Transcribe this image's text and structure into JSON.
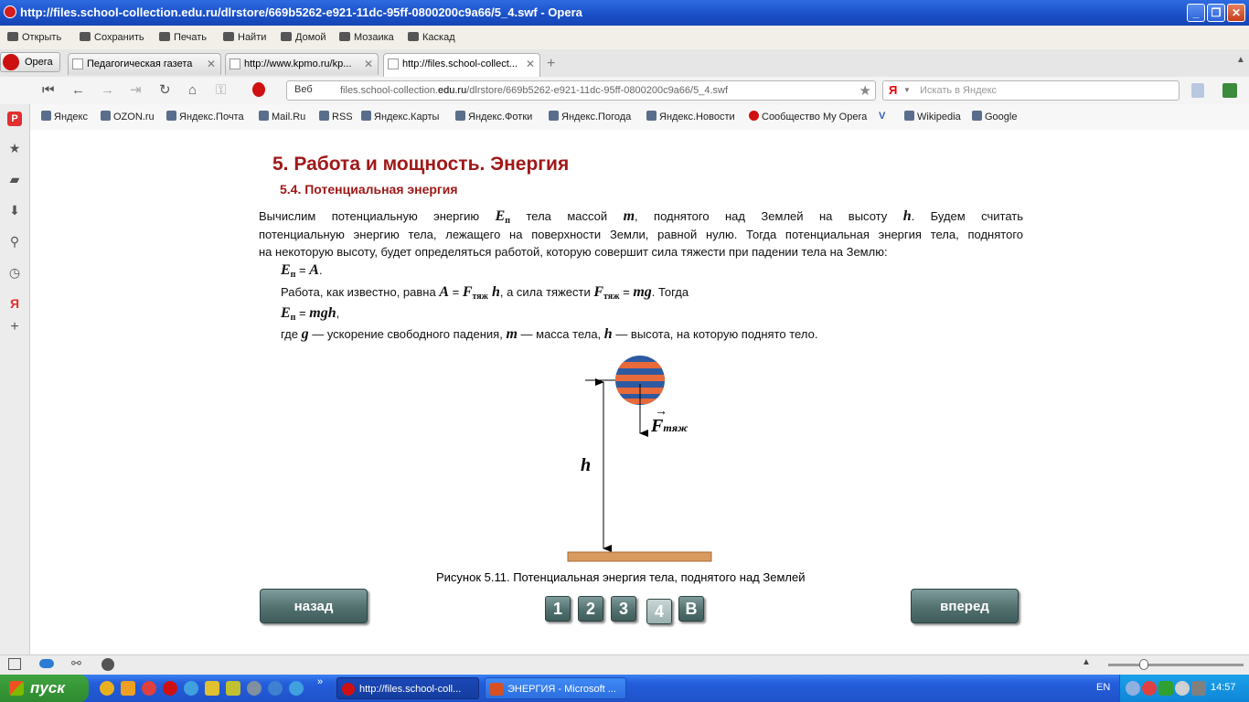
{
  "window": {
    "title": "http://files.school-collection.edu.ru/dlrstore/669b5262-e921-11dc-95ff-0800200c9a66/5_4.swf - Opera"
  },
  "menu": [
    "Открыть",
    "Сохранить",
    "Печать",
    "Найти",
    "Домой",
    "Мозаика",
    "Каскад"
  ],
  "opera_button": "Opera",
  "tabs": [
    "Педагогическая газета",
    "http://www.kpmo.ru/kp...",
    "http://files.school-collect..."
  ],
  "address": {
    "web_label": "Веб",
    "url_prefix": "files.school-collection.",
    "url_host": "edu.ru",
    "url_path": "/dlrstore/669b5262-e921-11dc-95ff-0800200c9a66/5_4.swf"
  },
  "search": {
    "engine": "Я",
    "placeholder": "Искать в Яндекс"
  },
  "bookmarks": [
    "Яндекс",
    "OZON.ru",
    "Яндекс.Почта",
    "Mail.Ru",
    "RSS",
    "Яндекс.Карты",
    "Яндекс.Фотки",
    "Яндекс.Погода",
    "Яндекс.Новости",
    "Сообщество My Opera",
    "Wikipedia",
    "Google"
  ],
  "page": {
    "h1": "5. Работа и мощность. Энергия",
    "h2": "5.4. Потенциальная энергия",
    "p1": {
      "a": "Вычислим потенциальную энергию ",
      "E": "E",
      "Esub": "п",
      "b": " тела массой ",
      "m": "m",
      "c": ", поднятого над Землей на высоту ",
      "h": "h",
      "d": ". Будем считать"
    },
    "p2": "потенциальную энергию тела, лежащего на поверхности Земли, равной нулю. Тогда потенциальная энергия тела, поднятого",
    "p3": "на некоторую высоту, будет определяться работой, которую совершит сила тяжести при падении тела на Землю:",
    "eq1": {
      "E": "E",
      "sub": "п",
      "rest": " = ",
      "A": "A",
      "end": "."
    },
    "p4": {
      "a": "Работа, как известно, равна ",
      "A": "A",
      "eq": " = ",
      "F": "F",
      "Fsub": "тяж",
      "h": " h",
      "b": ", а сила тяжести ",
      "F2": "F",
      "F2sub": "тяж",
      "eq2": " = ",
      "mg": "mg",
      "c": ". Тогда"
    },
    "eq2": {
      "E": "E",
      "sub": "п",
      "rest": " = ",
      "mgh": "mgh",
      "end": ","
    },
    "p5": {
      "a": "где ",
      "g": "g",
      "b": " — ускорение свободного падения, ",
      "m": "m",
      "c": " — масса тела, ",
      "h": "h",
      "d": " — высота, на которую поднято тело."
    },
    "figure": {
      "force_label": "F",
      "force_sub": "тяж",
      "height_label": "h"
    },
    "caption": "Рисунок 5.11. Потенциальная энергия тела, поднятого над Землей",
    "back_button": "назад",
    "forward_button": "вперед",
    "pages": [
      "1",
      "2",
      "3",
      "4",
      "B"
    ],
    "current_page": "4"
  },
  "taskbar": {
    "start": "пуск",
    "tasks": [
      "http://files.school-coll...",
      "ЭНЕРГИЯ - Microsoft ..."
    ],
    "lang": "EN",
    "clock": "14:57"
  },
  "colors": {
    "heading": "#a01818",
    "button": "#52706e"
  }
}
